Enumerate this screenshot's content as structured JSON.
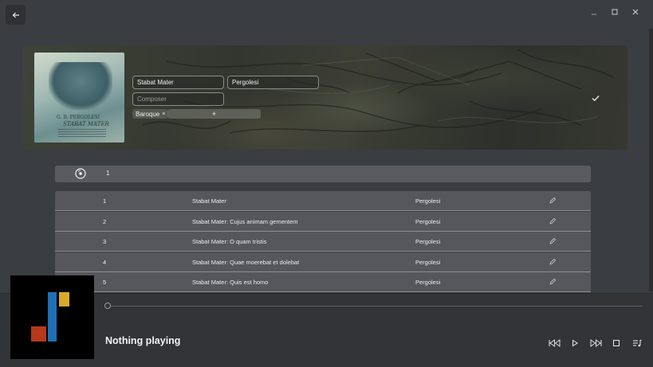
{
  "window": {
    "back_icon": "arrow-left-icon",
    "controls": [
      "minimize-icon",
      "maximize-icon",
      "close-icon"
    ]
  },
  "album": {
    "cover_text_line1": "G. B. PERGOLESI",
    "cover_text_line2": "STABAT MATER",
    "title_value": "Stabat Mater",
    "artist_value": "Pergolesi",
    "composer_placeholder": "Composer",
    "genre_chip": "Baroque",
    "genre_remove": "×",
    "add_genre_label": "+",
    "confirm_icon": "checkmark-icon"
  },
  "disc": {
    "icon": "disc-icon",
    "number": "1"
  },
  "tracks": [
    {
      "number": "1",
      "title": "Stabat Mater",
      "artist": "Pergolesi"
    },
    {
      "number": "2",
      "title": "Stabat Mater: Cujus animam gementem",
      "artist": "Pergolesi"
    },
    {
      "number": "3",
      "title": "Stabat Mater: O quam tristis",
      "artist": "Pergolesi"
    },
    {
      "number": "4",
      "title": "Stabat Mater: Quae moerebat et dolebat",
      "artist": "Pergolesi"
    },
    {
      "number": "5",
      "title": "Stabat Mater: Quis est homo",
      "artist": "Pergolesi"
    }
  ],
  "player": {
    "status": "Nothing playing",
    "seek_progress": 0,
    "controls": [
      "skip-back-icon",
      "play-icon",
      "skip-forward-icon",
      "stop-icon",
      "queue-icon"
    ],
    "logo_colors": {
      "red": "#b5391a",
      "blue": "#1f6fb5",
      "yellow": "#d8a92a"
    }
  },
  "colors": {
    "background": "#3a3d41",
    "track_row": "#55575c",
    "disc_bar": "#595b60"
  }
}
